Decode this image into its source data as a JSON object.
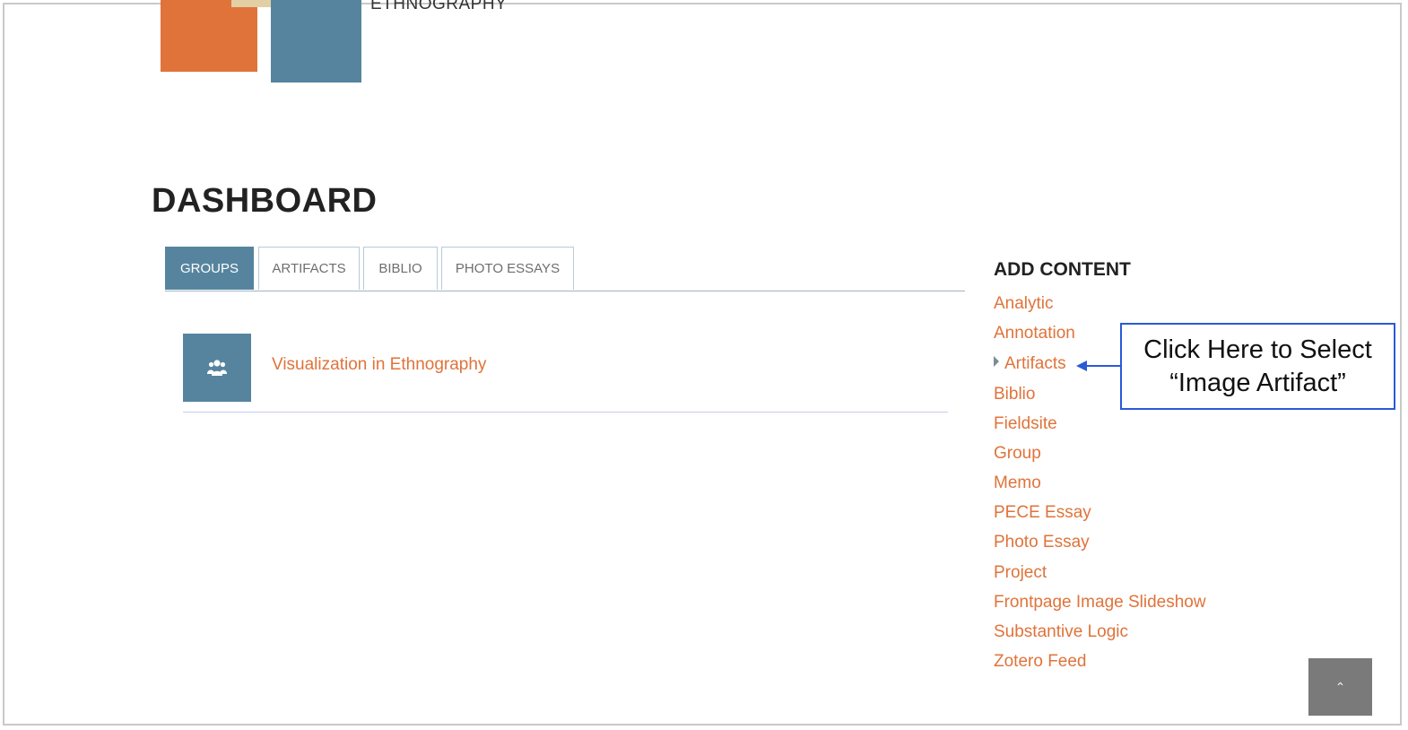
{
  "site": {
    "name": "ETHNOGRAPHY"
  },
  "page": {
    "title": "DASHBOARD"
  },
  "tabs": [
    {
      "label": "GROUPS",
      "active": true
    },
    {
      "label": "ARTIFACTS",
      "active": false
    },
    {
      "label": "BIBLIO",
      "active": false
    },
    {
      "label": "PHOTO ESSAYS",
      "active": false
    }
  ],
  "groups": [
    {
      "name": "Visualization in Ethnography",
      "icon": "group-icon"
    }
  ],
  "add_content": {
    "title": "ADD CONTENT",
    "items": [
      {
        "label": "Analytic"
      },
      {
        "label": "Annotation"
      },
      {
        "label": "Artifacts",
        "expandable": true
      },
      {
        "label": "Biblio"
      },
      {
        "label": "Fieldsite"
      },
      {
        "label": "Group"
      },
      {
        "label": "Memo"
      },
      {
        "label": "PECE Essay"
      },
      {
        "label": "Photo Essay"
      },
      {
        "label": "Project"
      },
      {
        "label": "Frontpage Image Slideshow"
      },
      {
        "label": "Substantive Logic"
      },
      {
        "label": "Zotero Feed"
      }
    ]
  },
  "callout": {
    "line1": "Click Here to Select",
    "line2": "“Image Artifact”"
  },
  "back_to_top": {
    "icon": "chevron-up-icon",
    "glyph": "⌃"
  },
  "colors": {
    "accent": "#e0733a",
    "brand_blue": "#56849e",
    "callout_border": "#2a5ad6"
  }
}
